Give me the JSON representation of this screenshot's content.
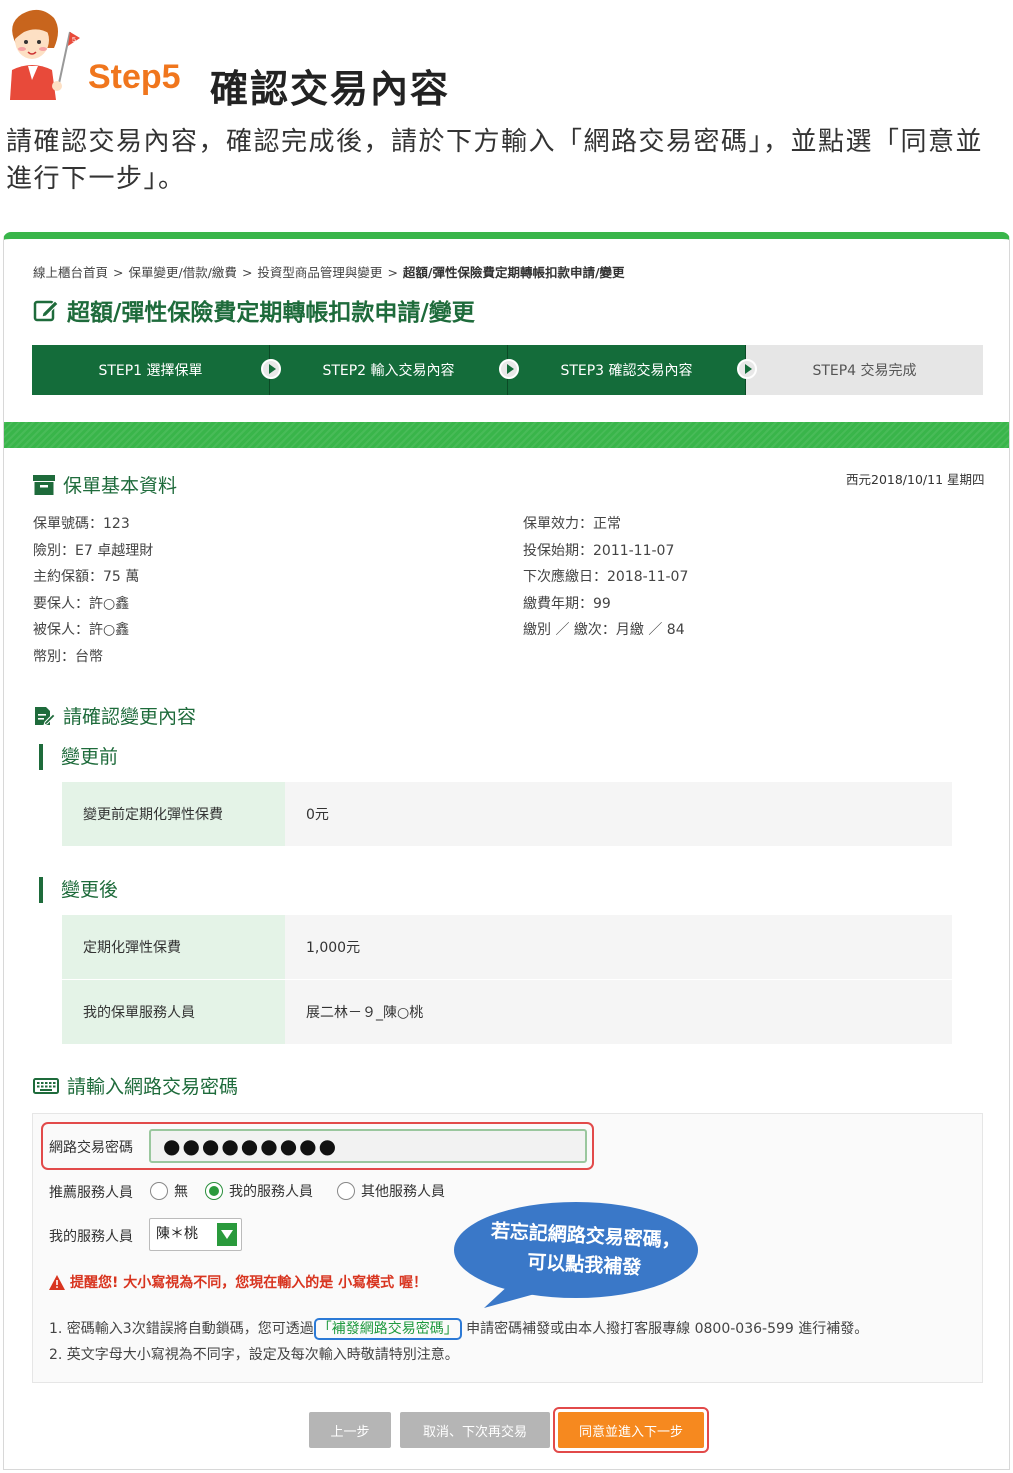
{
  "header": {
    "step": "Step5",
    "title": "確認交易內容",
    "intro": "請確認交易內容，確認完成後，請於下方輸入「網路交易密碼」，並點選「同意並進行下一步」。",
    "flag_number": "5"
  },
  "breadcrumb": [
    "線上櫃台首頁",
    "保單變更/借款/繳費",
    "投資型商品管理與變更",
    "超額/彈性保險費定期轉帳扣款申請/變更"
  ],
  "breadcrumb_sep": ">",
  "page_title": "超額/彈性保險費定期轉帳扣款申請/變更",
  "stepper": [
    {
      "label": "STEP1 選擇保單",
      "active": true
    },
    {
      "label": "STEP2 輸入交易內容",
      "active": true
    },
    {
      "label": "STEP3 確認交易內容",
      "active": true
    },
    {
      "label": "STEP4 交易完成",
      "active": false
    }
  ],
  "policy": {
    "heading": "保單基本資料",
    "date": "西元2018/10/11 星期四",
    "left": [
      "保單號碼：123",
      "險別：E7 卓越理財",
      "主約保額：75 萬",
      "要保人：許○鑫",
      "被保人：許○鑫",
      "幣別：台幣"
    ],
    "right": [
      "保單效力：正常",
      "投保始期：2011-11-07",
      "下次應繳日：2018-11-07",
      "繳費年期：99",
      "繳別 ／ 繳次：月繳 ／ 84"
    ]
  },
  "confirm": {
    "heading": "請確認變更內容",
    "before_heading": "變更前",
    "before_rows": [
      {
        "k": "變更前定期化彈性保費",
        "v": "0元"
      }
    ],
    "after_heading": "變更後",
    "after_rows": [
      {
        "k": "定期化彈性保費",
        "v": "1,000元"
      },
      {
        "k": "我的保單服務人員",
        "v": "展二林－９_陳○桃"
      }
    ]
  },
  "password": {
    "heading": "請輸入網路交易密碼",
    "label": "網路交易密碼",
    "value": "●●●●●●●●●",
    "recommend_label": "推薦服務人員",
    "options": [
      {
        "label": "無",
        "selected": false
      },
      {
        "label": "我的服務人員",
        "selected": true
      },
      {
        "label": "其他服務人員",
        "selected": false
      }
    ],
    "my_agent_label": "我的服務人員",
    "my_agent_value": "陳＊桃",
    "warning": "提醒您! 大小寫視為不同，您現在輸入的是 小寫模式 喔！",
    "note1_pre": "1. 密碼輸入3次錯誤將自動鎖碼，您可透過",
    "note1_link": "「補發網路交易密碼」",
    "note1_post": "申請密碼補發或由本人撥打客服專線 0800-036-599 進行補發。",
    "note2": "2. 英文字母大小寫視為不同字，設定及每次輸入時敬請特別注意。",
    "bubble_line1": "若忘記網路交易密碼，",
    "bubble_line2": "可以點我補發"
  },
  "buttons": {
    "prev": "上一步",
    "cancel": "取消、下次再交易",
    "next": "同意並進入下一步"
  },
  "colors": {
    "accent": "#f0761d",
    "brand_green": "#146c3a",
    "band_green": "#39b54a",
    "highlight_red": "#e24a4a",
    "link_blue": "#2c7ad6"
  }
}
